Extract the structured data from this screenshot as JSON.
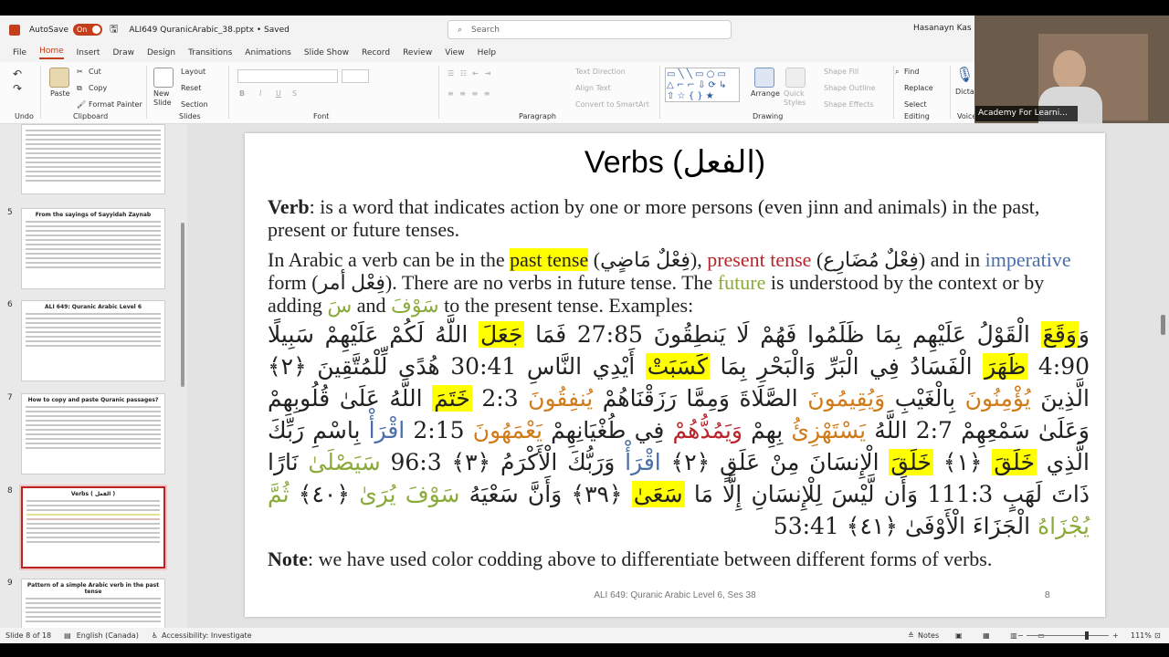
{
  "titlebar": {
    "autosave_label": "AutoSave",
    "autosave_state": "On",
    "doc_title": "ALI649 QuranicArabic_38.pptx • Saved",
    "search_placeholder": "Search",
    "user": "Hasanayn Kas"
  },
  "menu": [
    "File",
    "Home",
    "Insert",
    "Draw",
    "Design",
    "Transitions",
    "Animations",
    "Slide Show",
    "Record",
    "Review",
    "View",
    "Help"
  ],
  "menu_active": "Home",
  "ribbon": {
    "undo_label": "Undo",
    "clipboard": {
      "paste": "Paste",
      "cut": "Cut",
      "copy": "Copy",
      "format_painter": "Format Painter",
      "label": "Clipboard"
    },
    "slides": {
      "new_slide": "New Slide",
      "layout": "Layout",
      "reset": "Reset",
      "section": "Section",
      "label": "Slides"
    },
    "font_label": "Font",
    "paragraph": {
      "text_direction": "Text Direction",
      "align_text": "Align Text",
      "smartart": "Convert to SmartArt",
      "label": "Paragraph"
    },
    "drawing": {
      "arrange": "Arrange",
      "quick_styles": "Quick Styles",
      "shape_fill": "Shape Fill",
      "shape_outline": "Shape Outline",
      "shape_effects": "Shape Effects",
      "label": "Drawing"
    },
    "editing": {
      "find": "Find",
      "replace": "Replace",
      "select": "Select",
      "label": "Editing"
    },
    "voice": {
      "dictate": "Dictat",
      "label": "Voice"
    }
  },
  "video": {
    "label": "Academy For Learni..."
  },
  "thumbnails": [
    {
      "num": "5",
      "title": "From the sayings of Sayyidah Zaynab"
    },
    {
      "num": "6",
      "title": "ALI 649: Quranic Arabic Level 6"
    },
    {
      "num": "7",
      "title": "How to copy and paste Quranic passages?"
    },
    {
      "num": "8",
      "title": "Verbs ( الفعل )"
    },
    {
      "num": "9",
      "title": "Pattern of a simple Arabic verb in the past tense"
    }
  ],
  "slide": {
    "title": "Verbs (الفعل)",
    "verb_term": "Verb",
    "verb_def": ": is a word that indicates action by one or more persons (even jinn and animals) in the past, present or future tenses.",
    "p2_a": "In Arabic a verb can be in the ",
    "past_tense": "past tense",
    "past_ar": " (فِعْلٌ مَاضٍي), ",
    "present_tense": "present tense",
    "present_ar": " (فِعْلٌ مُضَارِع) and in ",
    "imperative": "imperative",
    "p2_b": " form (فِعْل أمر). There are no verbs in future tense. The ",
    "future": "future",
    "p2_c": " is understood by the context or by adding ",
    "sa": "سَ",
    "and": " and ",
    "sawfa": "سَوْفَ",
    "p2_d": " to the present tense. Examples:",
    "ar1": "وَ",
    "ar_waqa": "وَقَعَ",
    "ar2": " الْقَوْلُ عَلَيْهِم بِمَا ظَلَمُوا فَهُمْ لَا يَنطِقُونَ 27:85 فَمَا ",
    "ar_jaala": "جَعَلَ",
    "ar3": " اللَّهُ لَكُمْ عَلَيْهِمْ سَبِيلًا 4:90 ",
    "ar_zahara": "ظَهَرَ",
    "ar4": " الْفَسَادُ فِي الْبَرِّ وَالْبَحْرِ بِمَا ",
    "ar_kasabat": "كَسَبَتْ",
    "ar5": " أَيْدِي النَّاسِ 30:41 هُدًى لِّلْمُتَّقِينَ ﴿٢﴾ الَّذِينَ ",
    "ar_yuminuna": "يُؤْمِنُونَ",
    "ar6": " بِالْغَيْبِ ",
    "ar_yuqimuna": "وَيُقِيمُونَ",
    "ar7": " الصَّلَاةَ وَمِمَّا رَزَقْنَاهُمْ ",
    "ar_yunfiquna": "يُنفِقُونَ",
    "ar8": " 2:3 ",
    "ar_khatama": "خَتَمَ",
    "ar9": " اللَّهُ عَلَىٰ قُلُوبِهِمْ وَعَلَىٰ سَمْعِهِمْ 2:7 اللَّهُ ",
    "ar_yastahziu": "يَسْتَهْزِئُ",
    "ar10": " بِهِمْ ",
    "ar_yamudduhum": "وَيَمُدُّهُمْ",
    "ar11": " فِي طُغْيَانِهِمْ ",
    "ar_yamahuna": "يَعْمَهُونَ",
    "ar12": " 2:15 ",
    "ar_iqra1": "اقْرَأْ",
    "ar13": " بِاسْمِ رَبِّكَ الَّذِي ",
    "ar_khalaqa1": "خَلَقَ",
    "ar14": " ﴿١﴾ ",
    "ar_khalaqa2": "خَلَقَ",
    "ar15": " الْإِنسَانَ مِنْ عَلَقٍ ﴿٢﴾ ",
    "ar_iqra2": "اقْرَأْ",
    "ar16": " وَرَبُّكَ الْأَكْرَمُ ﴿٣﴾ 96:3 ",
    "ar_sayasla": "سَيَصْلَىٰ",
    "ar17": " نَارًا ذَاتَ لَهَبٍ 111:3 وَأَن لَّيْسَ لِلْإِنسَانِ إِلَّا مَا ",
    "ar_saa": "سَعَىٰ",
    "ar18": " ﴿٣٩﴾ وَأَنَّ سَعْيَهُ ",
    "ar_sawfa_yura": "سَوْفَ يُرَىٰ",
    "ar19": " ﴿٤٠﴾ ",
    "ar_thumma": "ثُمَّ يُجْزَاهُ",
    "ar20": " الْجَزَاءَ الْأَوْفَىٰ ﴿٤١﴾ 53:41",
    "note_term": "Note",
    "note_text": ": we have used color codding above to differentiate between different forms of verbs.",
    "footer": "ALI 649: Quranic Arabic Level 6, Ses 38",
    "page_num": "8"
  },
  "status": {
    "slide_of": "Slide 8 of 18",
    "language": "English (Canada)",
    "accessibility": "Accessibility: Investigate",
    "notes": "Notes",
    "zoom": "111%"
  },
  "colors": {
    "accent": "#c43e1c",
    "highlight": "#ffff00",
    "present": "#b8242a",
    "imperative": "#4a6ea8",
    "future": "#8aaa3a",
    "orange": "#d07a1a"
  }
}
